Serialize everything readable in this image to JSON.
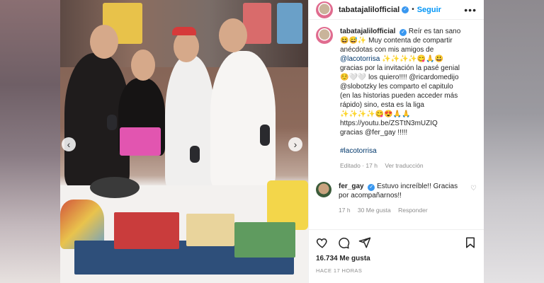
{
  "post": {
    "username": "tabatajalilofficial",
    "follow_label": "Seguir",
    "caption": {
      "line1": "Reír es tan sano",
      "line2": "😆😅✨ Muy contenta de compartir",
      "line3": "anécdotas con mis amigos de",
      "line4": "@lacotorrisa ✨✨✨✨😋🙏😃",
      "line5": "gracias por la invitación la pasé genial",
      "line6": "☺️🤍🤍 los quiero!!!! @ricardomedijo",
      "line7": "@slobotzky les comparto el capitulo",
      "line8": "(en las historias pueden acceder más",
      "line9": "rápido) sino, esta es la liga",
      "line10": "✨✨✨✨😋😍🙏🙏",
      "line11": "https://youtu.be/ZSTtN3mUZIQ",
      "line12": "gracias @fer_gay !!!!!",
      "hashtag": "#lacotorrisa"
    },
    "caption_meta": {
      "edited": "Editado · 17 h",
      "translation": "Ver traducción"
    },
    "reply": {
      "username": "fer_gay",
      "text1": "Estuvo increíble!! Gracias",
      "text2": "por acompañarnos!!",
      "time": "17 h",
      "likes": "30 Me gusta",
      "reply_label": "Responder"
    },
    "likes_count": "16.734 Me gusta",
    "time_ago": "HACE 17 HORAS"
  },
  "icons": {
    "verified": "verified-badge-icon",
    "more": "more-options-icon",
    "like": "heart-icon",
    "comment": "comment-icon",
    "share": "paper-plane-icon",
    "save": "bookmark-icon",
    "prev": "chevron-left-icon",
    "next": "chevron-right-icon"
  },
  "colors": {
    "accent": "#0095f6",
    "verified": "#3897f0",
    "link": "#00376b"
  }
}
